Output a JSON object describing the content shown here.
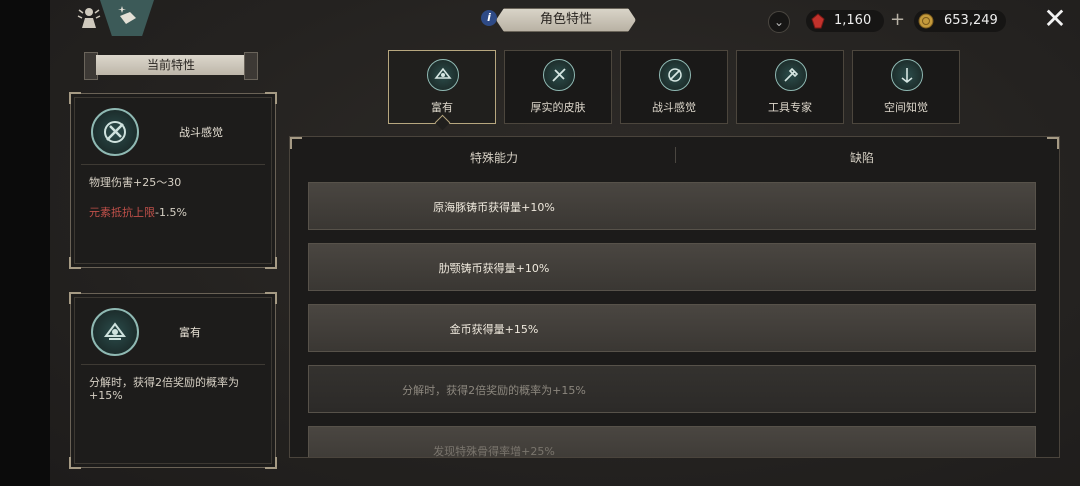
{
  "header": {
    "title": "角色特性",
    "currency_red": "1,160",
    "currency_gold": "653,249",
    "icons": [
      "character-icon",
      "menu-flag-icon",
      "info-icon",
      "chevron-down-icon",
      "ruby-icon",
      "gold-coin-icon",
      "plus-icon",
      "close-icon"
    ]
  },
  "left_panel": {
    "section_title": "当前特性",
    "cards": [
      {
        "title": "战斗感觉",
        "line1": "物理伤害+25～30",
        "line2_prefix": "元素抵抗上限",
        "line2_value": "-1.5%"
      },
      {
        "title": "富有",
        "line1": "分解时，获得2倍奖励的概率为",
        "line1b": "+15%"
      }
    ]
  },
  "tabs": [
    {
      "label": "富有",
      "selected": true
    },
    {
      "label": "厚实的皮肤",
      "selected": false
    },
    {
      "label": "战斗感觉",
      "selected": false
    },
    {
      "label": "工具专家",
      "selected": false
    },
    {
      "label": "空间知觉",
      "selected": false
    }
  ],
  "list": {
    "col_special": "特殊能力",
    "col_defect": "缺陷",
    "rows": [
      "原海豚铸币获得量+10%",
      "肋颚铸币获得量+10%",
      "金币获得量+15%",
      "分解时，获得2倍奖励的概率为+15%",
      "发现特殊骨得率增+25%"
    ]
  },
  "colors": {
    "accent_teal": "#8fb9b3",
    "negative_red": "#c0504a",
    "gold_border": "#b7a77f"
  }
}
